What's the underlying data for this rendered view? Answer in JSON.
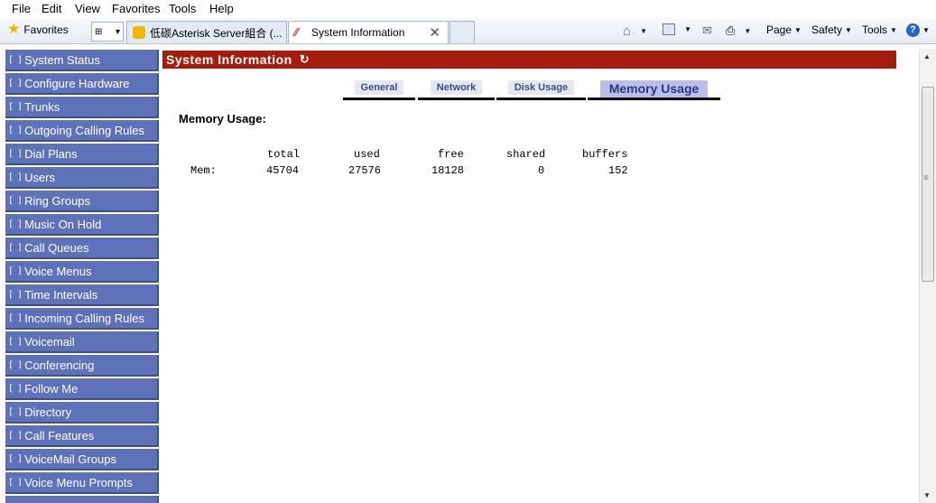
{
  "menubar": {
    "items": [
      "File",
      "Edit",
      "View",
      "Favorites",
      "Tools",
      "Help"
    ]
  },
  "toolbar": {
    "favorites_label": "Favorites",
    "tabs": [
      {
        "label": "低碳Asterisk Server組合 (...",
        "active": false
      },
      {
        "label": "System Information",
        "active": true
      }
    ],
    "commands": [
      "Page",
      "Safety",
      "Tools"
    ]
  },
  "sidebar": {
    "items": [
      "System Status",
      "Configure Hardware",
      "Trunks",
      "Outgoing Calling Rules",
      "Dial Plans",
      "Users",
      "Ring Groups",
      "Music On Hold",
      "Call Queues",
      "Voice Menus",
      "Time Intervals",
      "Incoming Calling Rules",
      "Voicemail",
      "Conferencing",
      "Follow Me",
      "Directory",
      "Call Features",
      "VoiceMail Groups",
      "Voice Menu Prompts"
    ]
  },
  "main": {
    "title": "System Information",
    "tabs": [
      {
        "label": "General",
        "active": false
      },
      {
        "label": "Network",
        "active": false
      },
      {
        "label": "Disk Usage",
        "active": false
      },
      {
        "label": "Memory Usage",
        "active": true
      }
    ],
    "heading": "Memory Usage:",
    "memory": {
      "headers": [
        "total",
        "used",
        "free",
        "shared",
        "buffers"
      ],
      "row_label": "Mem:",
      "values": [
        "45704",
        "27576",
        "18128",
        "0",
        "152"
      ]
    }
  },
  "colors": {
    "title_bar": "#a31c0d",
    "sidebar_item": "#5d72b8",
    "active_tab": "#b9bfe8"
  }
}
